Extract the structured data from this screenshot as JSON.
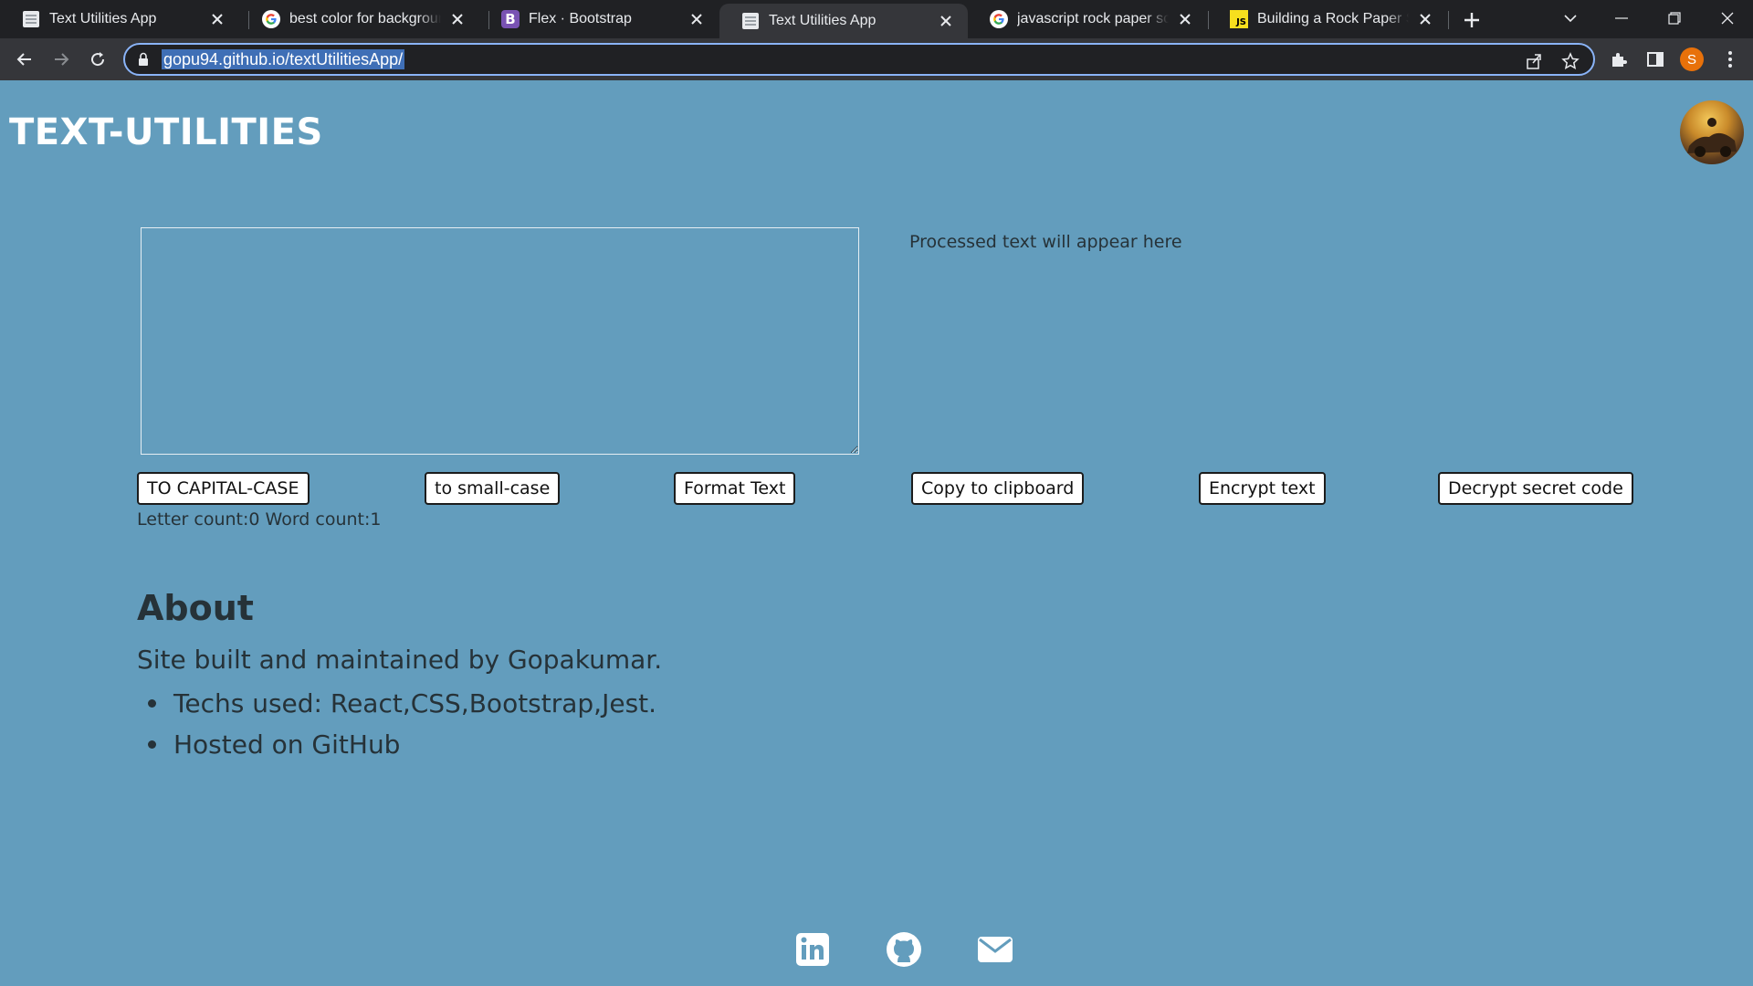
{
  "browser": {
    "tabs": [
      {
        "title": "Text Utilities App",
        "favicon": "page-icon",
        "active": false
      },
      {
        "title": "best color for background w",
        "favicon": "google-icon",
        "active": false
      },
      {
        "title": "Flex · Bootstrap",
        "favicon": "bootstrap-icon",
        "active": false
      },
      {
        "title": "Text Utilities App",
        "favicon": "page-icon",
        "active": true
      },
      {
        "title": "javascript rock paper scisso",
        "favicon": "google-icon",
        "active": false
      },
      {
        "title": "Building a Rock Paper Sciss",
        "favicon": "javascript-icon",
        "active": false
      }
    ],
    "favicon_letters": {
      "bootstrap": "B",
      "javascript": "JS"
    },
    "url": "gopu94.github.io/textUtilitiesApp/",
    "profile_initial": "S",
    "accent_color": "#8ab4f8"
  },
  "app": {
    "brand": "TEXT-UTILITIES",
    "background_color": "#639dbd",
    "textarea_value": "",
    "output_placeholder": "Processed text will appear here",
    "buttons": {
      "capital": "TO CAPITAL-CASE",
      "small": "to small-case",
      "format": "Format Text",
      "copy": "Copy to clipboard",
      "encrypt": "Encrypt text",
      "decrypt": "Decrypt secret code"
    },
    "counts": "Letter count:0 Word count:1",
    "about": {
      "heading": "About",
      "description": "Site built and maintained by Gopakumar.",
      "items": [
        "Techs used: React,CSS,Bootstrap,Jest.",
        "Hosted on GitHub"
      ]
    },
    "social_icons": [
      "linkedin-icon",
      "github-icon",
      "email-icon"
    ]
  }
}
